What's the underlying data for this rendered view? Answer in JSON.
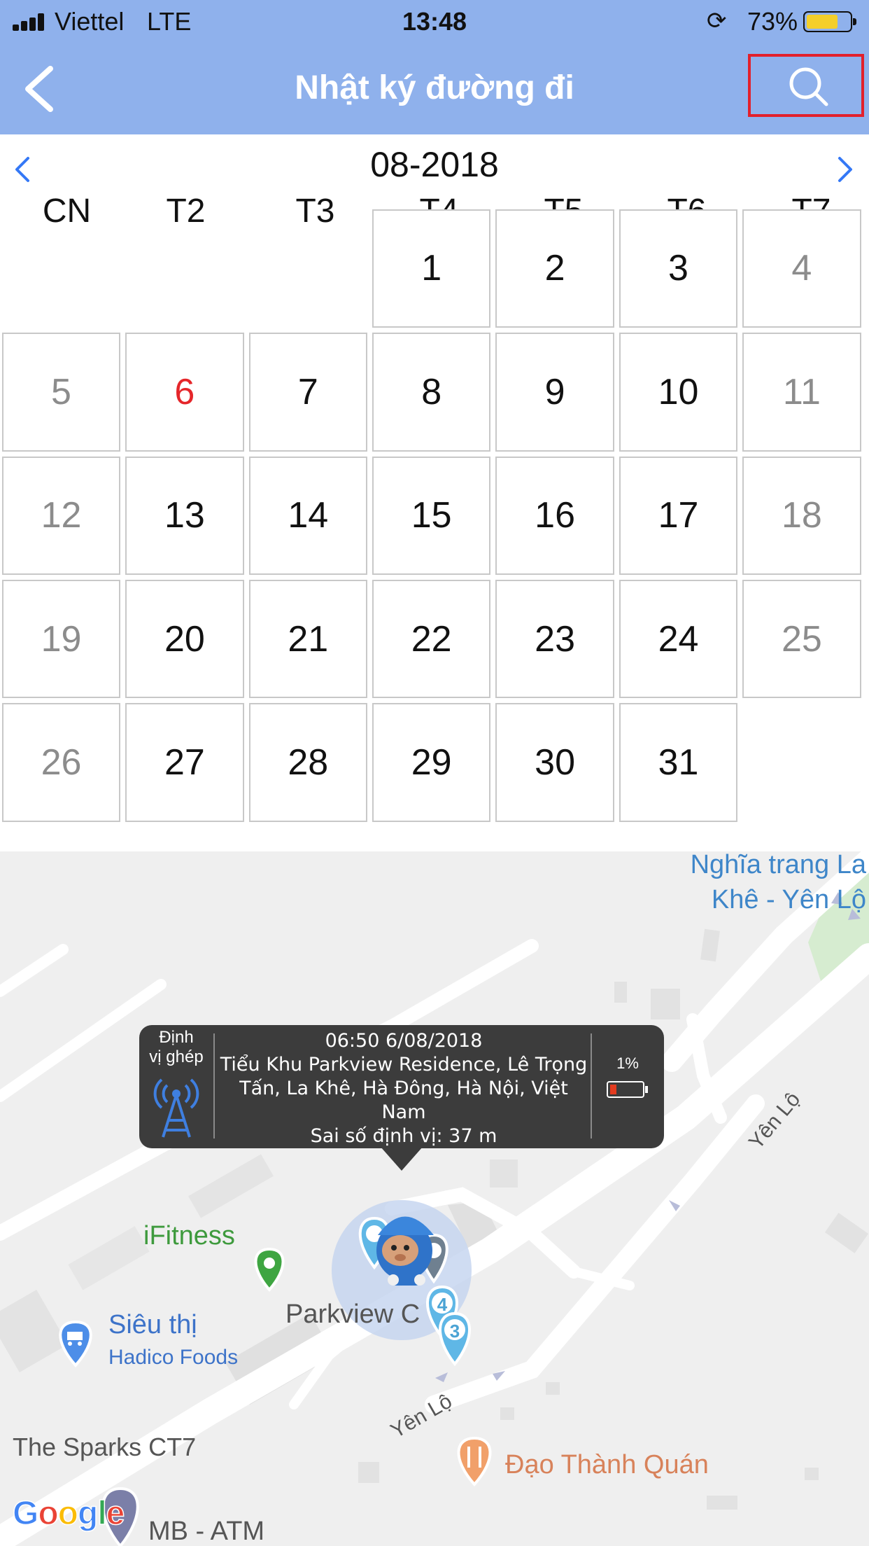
{
  "status_bar": {
    "carrier": "Viettel",
    "network": "LTE",
    "time": "13:48",
    "battery_percent": "73%",
    "battery_level": 0.73,
    "battery_color": "#f4cf2a"
  },
  "nav": {
    "title": "Nhật ký đường đi",
    "back_icon": "chevron-left-icon",
    "search_icon": "search-icon",
    "bar_color": "#8fb1ec",
    "highlight_color": "#e2202c"
  },
  "calendar": {
    "month_label": "08-2018",
    "weekdays": [
      "CN",
      "T2",
      "T3",
      "T4",
      "T5",
      "T6",
      "T7"
    ],
    "first_weekday_index": 3,
    "days_in_month": 31,
    "today": 6,
    "today_color": "#e5262a",
    "weekend_color": "#8c8c8c"
  },
  "map": {
    "labels": {
      "cemetery_line1": "Nghĩa trang La",
      "cemetery_line2": "Khê - Yên Lộ",
      "ifitness": "iFitness",
      "supermarket": "Siêu thị",
      "supermarket_sub": "Hadico Foods",
      "parkview": "Parkview C",
      "sparks": "The Sparks CT7",
      "restaurant": "Đạo Thành Quán",
      "atm": "MB - ATM",
      "road_1": "Yên Lộ",
      "road_2": "Yên Lộ",
      "google": "Google"
    },
    "popup": {
      "type_label_line1": "Định",
      "type_label_line2": "vị ghép",
      "type_icon": "antenna-icon",
      "datetime": "06:50 6/08/2018",
      "address_line1": "Tiểu Khu Parkview Residence, Lê Trọng",
      "address_line2": "Tấn, La Khê, Hà Đông, Hà Nội, Việt Nam",
      "accuracy": "Sai số định vị: 37 m",
      "battery_percent": "1%",
      "battery_level": 0.01
    },
    "markers": [
      {
        "name": "route-marker-4",
        "label": "4"
      },
      {
        "name": "route-marker-3",
        "label": "3"
      }
    ]
  }
}
